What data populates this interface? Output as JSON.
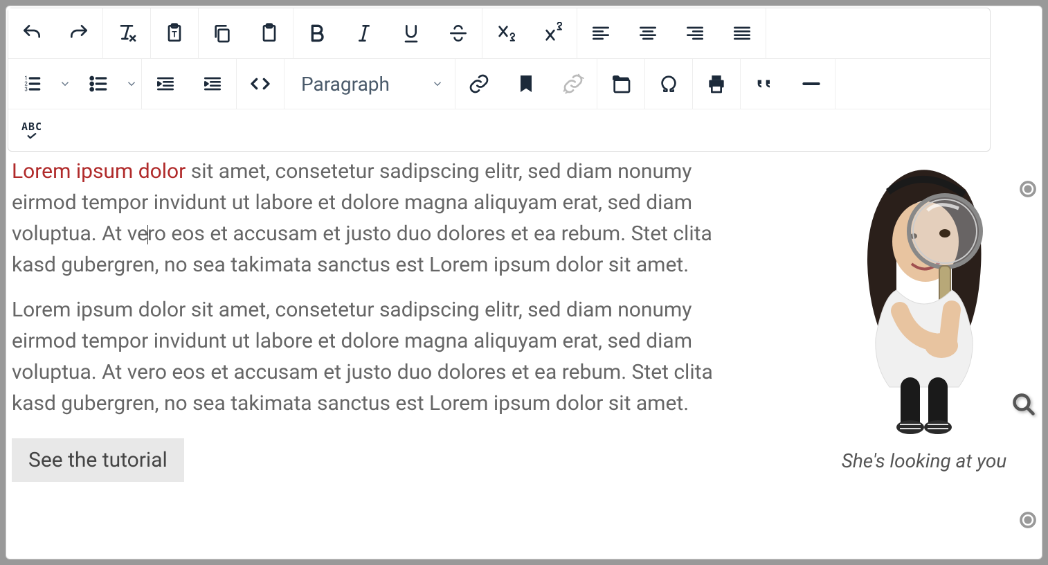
{
  "toolbar": {
    "paragraph_select": "Paragraph",
    "spellcheck_label": "ABC"
  },
  "content": {
    "link_text": "Lorem ipsum dolor",
    "para1_start": " sit amet, consetetur sadipscing elitr, sed diam nonumy eirmod tempor invidunt ut labore et dolore magna aliquyam erat, sed diam voluptua. At ve",
    "para1_end": "ro eos et accusam et justo duo dolores et ea rebum. Stet clita kasd gubergren, no sea takimata sanctus est Lorem ipsum dolor sit amet.",
    "para2": "Lorem ipsum dolor sit amet, consetetur sadipscing elitr, sed diam nonumy eirmod tempor invidunt ut labore et dolore magna aliquyam erat, sed diam voluptua. At vero eos et accusam et justo duo dolores et ea rebum. Stet clita kasd gubergren, no sea takimata sanctus est Lorem ipsum dolor sit amet.",
    "caption": "She's looking at you",
    "tutorial_button": "See the tutorial"
  }
}
